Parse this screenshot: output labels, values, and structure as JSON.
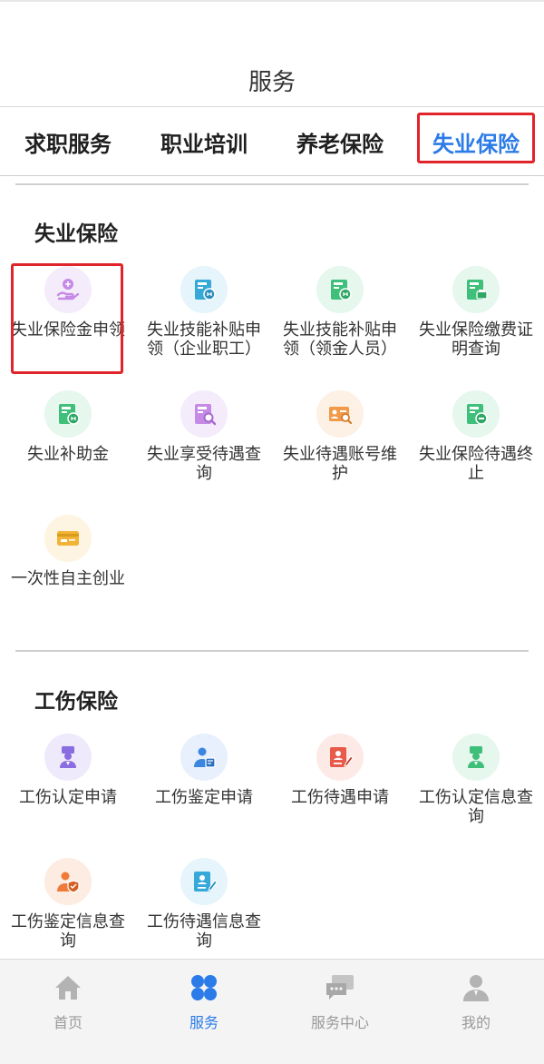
{
  "header": {
    "title": "服务"
  },
  "tabs": [
    {
      "label": "求职服务"
    },
    {
      "label": "职业培训"
    },
    {
      "label": "养老保险"
    },
    {
      "label": "失业保险",
      "active": true
    }
  ],
  "unemployment": {
    "title": "失业保险",
    "items": [
      {
        "label": "失业保险金申领",
        "icon": "hand-money-icon",
        "color": "#c58ae6"
      },
      {
        "label": "失业技能补贴申领（企业职工）",
        "icon": "subsidy-card-icon",
        "color": "#37a9d8"
      },
      {
        "label": "失业技能补贴申领（领金人员）",
        "icon": "subsidy-card-icon",
        "color": "#3fbf7a"
      },
      {
        "label": "失业保险缴费证明查询",
        "icon": "payment-print-icon",
        "color": "#3fbf7a"
      },
      {
        "label": "失业补助金",
        "icon": "subsidy-card-icon",
        "color": "#3fbf7a"
      },
      {
        "label": "失业享受待遇查询",
        "icon": "search-doc-icon",
        "color": "#c58ae6"
      },
      {
        "label": "失业待遇账号维护",
        "icon": "account-edit-icon",
        "color": "#f09a4a"
      },
      {
        "label": "失业保险待遇终止",
        "icon": "stop-card-icon",
        "color": "#3fbf7a"
      },
      {
        "label": "一次性自主创业",
        "icon": "card-icon",
        "color": "#f2b437"
      }
    ]
  },
  "injury": {
    "title": "工伤保险",
    "items": [
      {
        "label": "工伤认定申请",
        "icon": "person-id-icon",
        "color": "#8a6de0"
      },
      {
        "label": "工伤鉴定申请",
        "icon": "person-doc-icon",
        "color": "#3b86e0"
      },
      {
        "label": "工伤待遇申请",
        "icon": "doc-edit-icon",
        "color": "#e85a4a"
      },
      {
        "label": "工伤认定信息查询",
        "icon": "person-id-icon",
        "color": "#3fbf7a"
      },
      {
        "label": "工伤鉴定信息查询",
        "icon": "person-shield-icon",
        "color": "#f07a3a"
      },
      {
        "label": "工伤待遇信息查询",
        "icon": "doc-edit-icon",
        "color": "#37a9d8"
      }
    ]
  },
  "bottom_nav": [
    {
      "label": "首页",
      "icon": "home-icon"
    },
    {
      "label": "服务",
      "icon": "grid-icon",
      "active": true
    },
    {
      "label": "服务中心",
      "icon": "chat-icon"
    },
    {
      "label": "我的",
      "icon": "user-icon"
    }
  ],
  "colors": {
    "accent": "#2b7be8",
    "highlight": "#e0242a",
    "inactive": "#9a9a9a"
  }
}
